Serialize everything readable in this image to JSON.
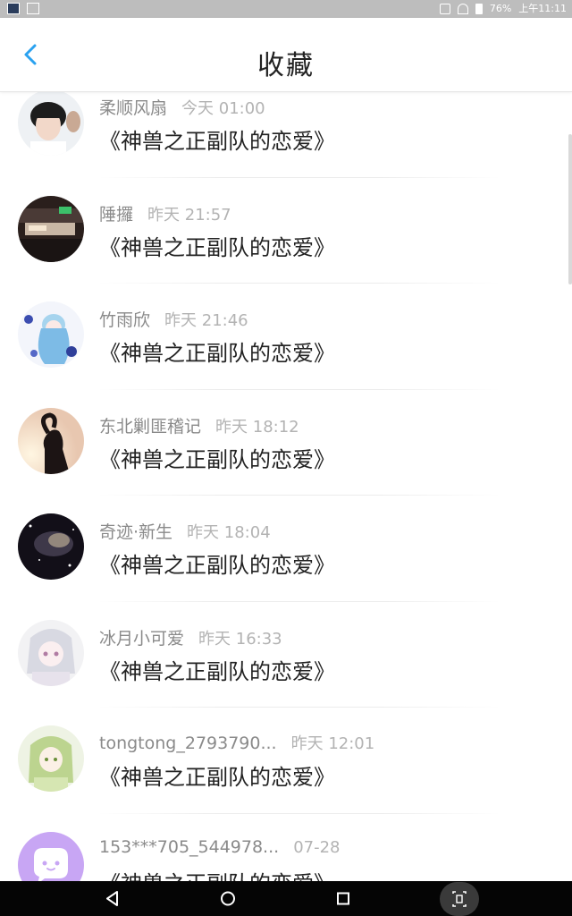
{
  "status_bar": {
    "battery": "76%",
    "time": "上午11:11"
  },
  "header": {
    "title": "收藏"
  },
  "items": [
    {
      "name": "柔顺风扇",
      "time": "今天 01:00",
      "content": "《神兽之正副队的恋爱》"
    },
    {
      "name": "陲攞",
      "time": "昨天 21:57",
      "content": "《神兽之正副队的恋爱》"
    },
    {
      "name": "竹雨欣",
      "time": "昨天 21:46",
      "content": "《神兽之正副队的恋爱》"
    },
    {
      "name": "东北剿匪稽记",
      "time": "昨天 18:12",
      "content": "《神兽之正副队的恋爱》"
    },
    {
      "name": "奇迹·新生",
      "time": "昨天 18:04",
      "content": "《神兽之正副队的恋爱》"
    },
    {
      "name": "冰月小可爱",
      "time": "昨天 16:33",
      "content": "《神兽之正副队的恋爱》"
    },
    {
      "name": "tongtong_2793790...",
      "time": "昨天 12:01",
      "content": "《神兽之正副队的恋爱》"
    },
    {
      "name": "153***705_544978...",
      "time": "07-28",
      "content": "《神兽之正副队的恋爱》"
    }
  ],
  "colors": {
    "accent": "#2aa2f0",
    "default_avatar": "#c8a6f4"
  }
}
